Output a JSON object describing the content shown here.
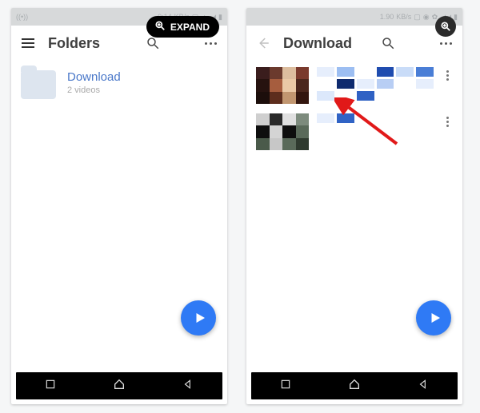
{
  "overlay": {
    "expand_label": "EXPAND"
  },
  "status": {
    "left": {
      "time": "0:14",
      "unit": "KB/s"
    },
    "right": {
      "net_label": "1.90",
      "net_unit": "KB/s"
    }
  },
  "phone_left": {
    "header": {
      "title": "Folders"
    },
    "folder": {
      "name": "Download",
      "subtitle": "2 videos"
    }
  },
  "phone_right": {
    "header": {
      "title": "Download"
    }
  },
  "colors": {
    "accent": "#2f7af5",
    "link": "#4a78c9",
    "arrow": "#e11919"
  }
}
